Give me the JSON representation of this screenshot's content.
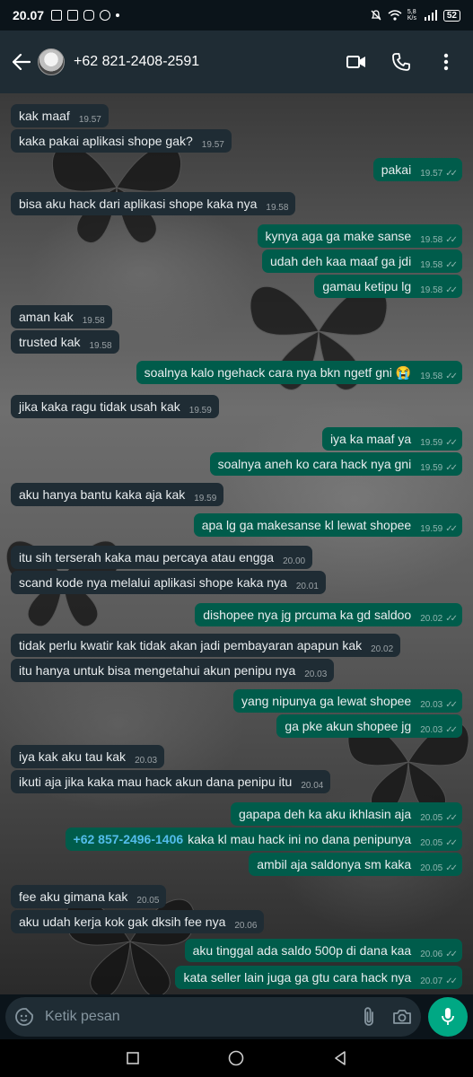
{
  "status_bar": {
    "time": "20.07",
    "battery": "52",
    "net_speed": "5,8\nK/s"
  },
  "header": {
    "contact": "+62 821-2408-2591"
  },
  "input": {
    "placeholder": "Ketik pesan"
  },
  "colors": {
    "incoming": "#1f2c34",
    "outgoing": "#005c4b",
    "link": "#53bdeb",
    "accent": "#00a884"
  },
  "icons": [
    "back-arrow-icon",
    "video-call-icon",
    "phone-icon",
    "more-icon",
    "sticker-icon",
    "attach-icon",
    "camera-icon",
    "mic-icon"
  ],
  "messages": [
    {
      "dir": "in",
      "text": "kak maaf",
      "time": "19.57"
    },
    {
      "dir": "in",
      "text": "kaka pakai aplikasi shope gak?",
      "time": "19.57"
    },
    {
      "dir": "out",
      "text": "pakai",
      "time": "19.57"
    },
    {
      "dir": "in",
      "text": "bisa aku hack dari aplikasi shope kaka nya",
      "time": "19.58"
    },
    {
      "dir": "out",
      "text": "kynya aga ga make sanse",
      "time": "19.58"
    },
    {
      "dir": "out",
      "text": "udah deh kaa maaf ga jdi",
      "time": "19.58"
    },
    {
      "dir": "out",
      "text": "gamau ketipu lg",
      "time": "19.58"
    },
    {
      "dir": "in",
      "text": "aman kak",
      "time": "19.58"
    },
    {
      "dir": "in",
      "text": "trusted kak",
      "time": "19.58"
    },
    {
      "dir": "out",
      "text": "soalnya kalo ngehack cara nya bkn ngetf gni 😭",
      "time": "19.58"
    },
    {
      "dir": "in",
      "text": "jika kaka ragu tidak usah kak",
      "time": "19.59"
    },
    {
      "dir": "out",
      "text": "iya ka maaf ya",
      "time": "19.59"
    },
    {
      "dir": "out",
      "text": "soalnya aneh ko cara hack nya gni",
      "time": "19.59"
    },
    {
      "dir": "in",
      "text": "aku hanya bantu kaka aja kak",
      "time": "19.59"
    },
    {
      "dir": "out",
      "text": "apa lg ga makesanse kl lewat shopee",
      "time": "19.59"
    },
    {
      "dir": "in",
      "text": "itu sih terserah kaka mau percaya atau engga",
      "time": "20.00"
    },
    {
      "dir": "in",
      "text": "scand kode nya melalui aplikasi shope kaka nya",
      "time": "20.01"
    },
    {
      "dir": "out",
      "text": "dishopee nya jg prcuma ka gd saldoo",
      "time": "20.02"
    },
    {
      "dir": "in",
      "text": "tidak perlu kwatir kak tidak akan jadi pembayaran apapun kak",
      "time": "20.02"
    },
    {
      "dir": "in",
      "text": "itu hanya untuk bisa mengetahui akun penipu nya",
      "time": "20.03"
    },
    {
      "dir": "out",
      "text": "yang nipunya ga lewat shopee",
      "time": "20.03"
    },
    {
      "dir": "out",
      "text": "ga pke akun shopee jg",
      "time": "20.03"
    },
    {
      "dir": "in",
      "text": "iya kak aku tau kak",
      "time": "20.03"
    },
    {
      "dir": "in",
      "text": "ikuti aja jika kaka mau hack akun dana penipu itu",
      "time": "20.04"
    },
    {
      "dir": "out",
      "text": "gapapa deh ka aku ikhlasin aja",
      "time": "20.05"
    },
    {
      "dir": "out",
      "link": "+62 857-2496-1406",
      "text": "kaka kl mau hack ini no dana penipunya",
      "time": "20.05"
    },
    {
      "dir": "out",
      "text": "ambil aja saldonya sm kaka",
      "time": "20.05"
    },
    {
      "dir": "in",
      "text": "fee aku gimana kak",
      "time": "20.05"
    },
    {
      "dir": "in",
      "text": "aku udah kerja kok gak dksih fee nya",
      "time": "20.06"
    },
    {
      "dir": "out",
      "text": "aku tinggal ada saldo 500p di dana kaa",
      "time": "20.06"
    },
    {
      "dir": "out",
      "text": "kata seller lain juga ga gtu cara hack nya",
      "time": "20.07"
    }
  ]
}
